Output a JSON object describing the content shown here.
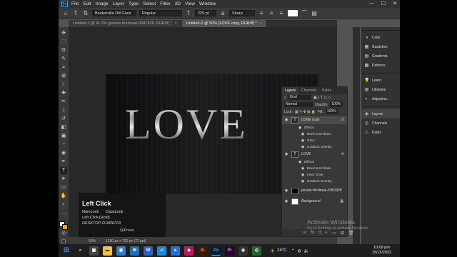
{
  "menubar": {
    "app_badge": "Ps",
    "items": [
      "File",
      "Edit",
      "Image",
      "Layer",
      "Type",
      "Select",
      "Filter",
      "3D",
      "View",
      "Window"
    ],
    "controls": [
      "—",
      "☐",
      "✕"
    ]
  },
  "options": {
    "font_family": "Baskerville Old Face",
    "font_style": "Regular",
    "font_size": "229 pt",
    "antialias": "Sharp"
  },
  "tabs": [
    {
      "label": "Untitled-1 @ 41.2% (pexels-thirdman-5981928, RGB/8) *",
      "close": "×"
    },
    {
      "label": "Untitled-2 @ 50% (LOVE copy, RGB/8) *",
      "close": "×"
    }
  ],
  "canvas": {
    "text": "LOVE"
  },
  "key_overlay": {
    "title": "Left Click",
    "keys": [
      "NumLock",
      "CapsLock"
    ],
    "line1": "Left Click [Hold]",
    "line2": "DESKTOP-D1MAVO3",
    "brand": "QiPress"
  },
  "status": {
    "zoom": "50%",
    "doc_size": "1280 px x 720 px (72 ppi)"
  },
  "layers_panel": {
    "tabs": [
      "Layers",
      "Channels",
      "Paths"
    ],
    "kind": "Kind",
    "blend": "Normal",
    "opacity_label": "Opacity:",
    "opacity": "100%",
    "lock_label": "Lock:",
    "fill_label": "Fill:",
    "fill": "100%",
    "fx": "fx",
    "layers": [
      {
        "name": "LOVE copy",
        "thumb": "T",
        "effects_label": "Effects",
        "effects": [
          "Bevel & Emboss",
          "Glow",
          "Gradient Overlay"
        ]
      },
      {
        "name": "LOVE",
        "thumb": "T",
        "effects_label": "Effects",
        "effects": [
          "Bevel & Emboss",
          "Inner Glow",
          "Gradient Overlay"
        ]
      },
      {
        "name": "pexels-thirdman-5981928"
      },
      {
        "name": "Background"
      }
    ]
  },
  "dock": {
    "groups": [
      [
        "Color",
        "Swatches",
        "Gradients",
        "Patterns"
      ],
      [
        "Learn",
        "Libraries",
        "Adjustme..."
      ],
      [
        "Layers",
        "Channels",
        "Paths"
      ]
    ]
  },
  "activation": {
    "title": "Activate Windows",
    "subtitle": "Go to Settings to activate Windows."
  },
  "taskbar": {
    "temperature": "24°C",
    "time": "10:09 pm",
    "date": "15/11/2022",
    "apps": [
      "Ai",
      "Ps",
      "Pr"
    ]
  },
  "colors": {
    "foreground": "#ffffff",
    "background": "#f7a21b"
  }
}
